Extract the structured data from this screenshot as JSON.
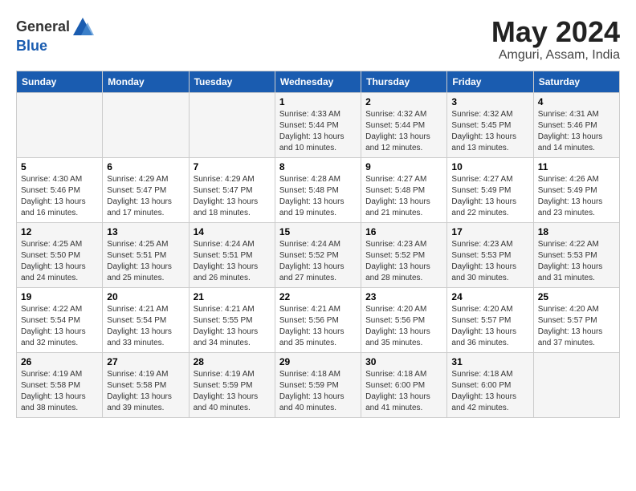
{
  "header": {
    "logo_general": "General",
    "logo_blue": "Blue",
    "month_title": "May 2024",
    "location": "Amguri, Assam, India"
  },
  "days_of_week": [
    "Sunday",
    "Monday",
    "Tuesday",
    "Wednesday",
    "Thursday",
    "Friday",
    "Saturday"
  ],
  "weeks": [
    [
      {
        "day": "",
        "info": ""
      },
      {
        "day": "",
        "info": ""
      },
      {
        "day": "",
        "info": ""
      },
      {
        "day": "1",
        "info": "Sunrise: 4:33 AM\nSunset: 5:44 PM\nDaylight: 13 hours\nand 10 minutes."
      },
      {
        "day": "2",
        "info": "Sunrise: 4:32 AM\nSunset: 5:44 PM\nDaylight: 13 hours\nand 12 minutes."
      },
      {
        "day": "3",
        "info": "Sunrise: 4:32 AM\nSunset: 5:45 PM\nDaylight: 13 hours\nand 13 minutes."
      },
      {
        "day": "4",
        "info": "Sunrise: 4:31 AM\nSunset: 5:46 PM\nDaylight: 13 hours\nand 14 minutes."
      }
    ],
    [
      {
        "day": "5",
        "info": "Sunrise: 4:30 AM\nSunset: 5:46 PM\nDaylight: 13 hours\nand 16 minutes."
      },
      {
        "day": "6",
        "info": "Sunrise: 4:29 AM\nSunset: 5:47 PM\nDaylight: 13 hours\nand 17 minutes."
      },
      {
        "day": "7",
        "info": "Sunrise: 4:29 AM\nSunset: 5:47 PM\nDaylight: 13 hours\nand 18 minutes."
      },
      {
        "day": "8",
        "info": "Sunrise: 4:28 AM\nSunset: 5:48 PM\nDaylight: 13 hours\nand 19 minutes."
      },
      {
        "day": "9",
        "info": "Sunrise: 4:27 AM\nSunset: 5:48 PM\nDaylight: 13 hours\nand 21 minutes."
      },
      {
        "day": "10",
        "info": "Sunrise: 4:27 AM\nSunset: 5:49 PM\nDaylight: 13 hours\nand 22 minutes."
      },
      {
        "day": "11",
        "info": "Sunrise: 4:26 AM\nSunset: 5:49 PM\nDaylight: 13 hours\nand 23 minutes."
      }
    ],
    [
      {
        "day": "12",
        "info": "Sunrise: 4:25 AM\nSunset: 5:50 PM\nDaylight: 13 hours\nand 24 minutes."
      },
      {
        "day": "13",
        "info": "Sunrise: 4:25 AM\nSunset: 5:51 PM\nDaylight: 13 hours\nand 25 minutes."
      },
      {
        "day": "14",
        "info": "Sunrise: 4:24 AM\nSunset: 5:51 PM\nDaylight: 13 hours\nand 26 minutes."
      },
      {
        "day": "15",
        "info": "Sunrise: 4:24 AM\nSunset: 5:52 PM\nDaylight: 13 hours\nand 27 minutes."
      },
      {
        "day": "16",
        "info": "Sunrise: 4:23 AM\nSunset: 5:52 PM\nDaylight: 13 hours\nand 28 minutes."
      },
      {
        "day": "17",
        "info": "Sunrise: 4:23 AM\nSunset: 5:53 PM\nDaylight: 13 hours\nand 30 minutes."
      },
      {
        "day": "18",
        "info": "Sunrise: 4:22 AM\nSunset: 5:53 PM\nDaylight: 13 hours\nand 31 minutes."
      }
    ],
    [
      {
        "day": "19",
        "info": "Sunrise: 4:22 AM\nSunset: 5:54 PM\nDaylight: 13 hours\nand 32 minutes."
      },
      {
        "day": "20",
        "info": "Sunrise: 4:21 AM\nSunset: 5:54 PM\nDaylight: 13 hours\nand 33 minutes."
      },
      {
        "day": "21",
        "info": "Sunrise: 4:21 AM\nSunset: 5:55 PM\nDaylight: 13 hours\nand 34 minutes."
      },
      {
        "day": "22",
        "info": "Sunrise: 4:21 AM\nSunset: 5:56 PM\nDaylight: 13 hours\nand 35 minutes."
      },
      {
        "day": "23",
        "info": "Sunrise: 4:20 AM\nSunset: 5:56 PM\nDaylight: 13 hours\nand 35 minutes."
      },
      {
        "day": "24",
        "info": "Sunrise: 4:20 AM\nSunset: 5:57 PM\nDaylight: 13 hours\nand 36 minutes."
      },
      {
        "day": "25",
        "info": "Sunrise: 4:20 AM\nSunset: 5:57 PM\nDaylight: 13 hours\nand 37 minutes."
      }
    ],
    [
      {
        "day": "26",
        "info": "Sunrise: 4:19 AM\nSunset: 5:58 PM\nDaylight: 13 hours\nand 38 minutes."
      },
      {
        "day": "27",
        "info": "Sunrise: 4:19 AM\nSunset: 5:58 PM\nDaylight: 13 hours\nand 39 minutes."
      },
      {
        "day": "28",
        "info": "Sunrise: 4:19 AM\nSunset: 5:59 PM\nDaylight: 13 hours\nand 40 minutes."
      },
      {
        "day": "29",
        "info": "Sunrise: 4:18 AM\nSunset: 5:59 PM\nDaylight: 13 hours\nand 40 minutes."
      },
      {
        "day": "30",
        "info": "Sunrise: 4:18 AM\nSunset: 6:00 PM\nDaylight: 13 hours\nand 41 minutes."
      },
      {
        "day": "31",
        "info": "Sunrise: 4:18 AM\nSunset: 6:00 PM\nDaylight: 13 hours\nand 42 minutes."
      },
      {
        "day": "",
        "info": ""
      }
    ]
  ]
}
